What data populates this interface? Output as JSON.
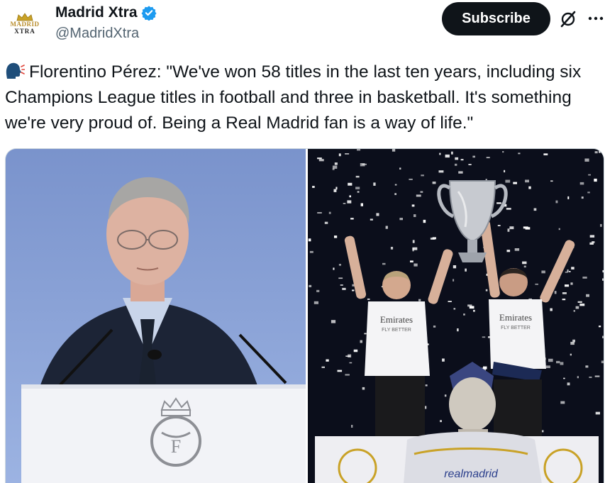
{
  "account": {
    "display_name": "Madrid Xtra",
    "handle": "@MadridXtra",
    "avatar_line1": "MADRID",
    "avatar_line2": "XTRA",
    "verified": true
  },
  "actions": {
    "subscribe_label": "Subscribe",
    "grok_icon": "grok-icon",
    "more_icon": "more-options-icon"
  },
  "tweet": {
    "emoji": "speaking-head-icon",
    "text": "Florentino Pérez: \"We've won 58 titles in the last ten years, including six Champions League titles in football and three in basketball. It's something we're very proud of. Being a Real Madrid fan is a way of life.\""
  },
  "media": {
    "photo_left": "florentino-perez-speaking-at-podium",
    "photo_right": "players-celebrating-with-champions-league-trophy",
    "shirt_sponsor": "Emirates",
    "shirt_sponsor_sub": "FLY BETTER",
    "banner_text": "realmadrid"
  },
  "colors": {
    "verified_blue": "#1d9bf0",
    "subscribe_bg": "#0f1419",
    "handle_gray": "#536471",
    "madrid_gold": "#c9a227"
  }
}
